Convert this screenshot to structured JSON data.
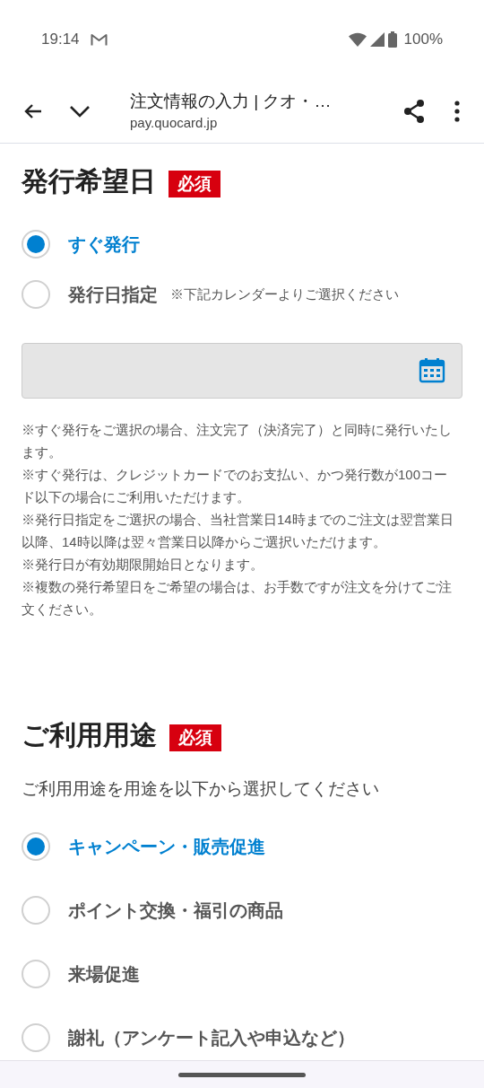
{
  "status_bar": {
    "time": "19:14",
    "battery": "100%"
  },
  "toolbar": {
    "title": "注文情報の入力 | クオ・…",
    "url": "pay.quocard.jp"
  },
  "sections": [
    {
      "title": "発行希望日",
      "badge": "必須",
      "options": [
        {
          "label": "すぐ発行",
          "selected": true
        },
        {
          "label": "発行日指定",
          "note": "※下記カレンダーよりご選択ください",
          "selected": false
        }
      ],
      "date_field": true,
      "notes": [
        "※すぐ発行をご選択の場合、注文完了（決済完了）と同時に発行いたします。",
        "※すぐ発行は、クレジットカードでのお支払い、かつ発行数が100コード以下の場合にご利用いただけます。",
        "※発行日指定をご選択の場合、当社営業日14時までのご注文は翌営業日以降、14時以降は翌々営業日以降からご選択いただけます。",
        "※発行日が有効期限開始日となります。",
        "※複数の発行希望日をご希望の場合は、お手数ですが注文を分けてご注文ください。"
      ]
    },
    {
      "title": "ご利用用途",
      "badge": "必須",
      "description": "ご利用用途を用途を以下から選択してください",
      "options": [
        {
          "label": "キャンペーン・販売促進",
          "selected": true
        },
        {
          "label": "ポイント交換・福引の商品",
          "selected": false
        },
        {
          "label": "来場促進",
          "selected": false
        },
        {
          "label": "謝礼（アンケート記入や申込など）",
          "selected": false
        }
      ]
    }
  ]
}
